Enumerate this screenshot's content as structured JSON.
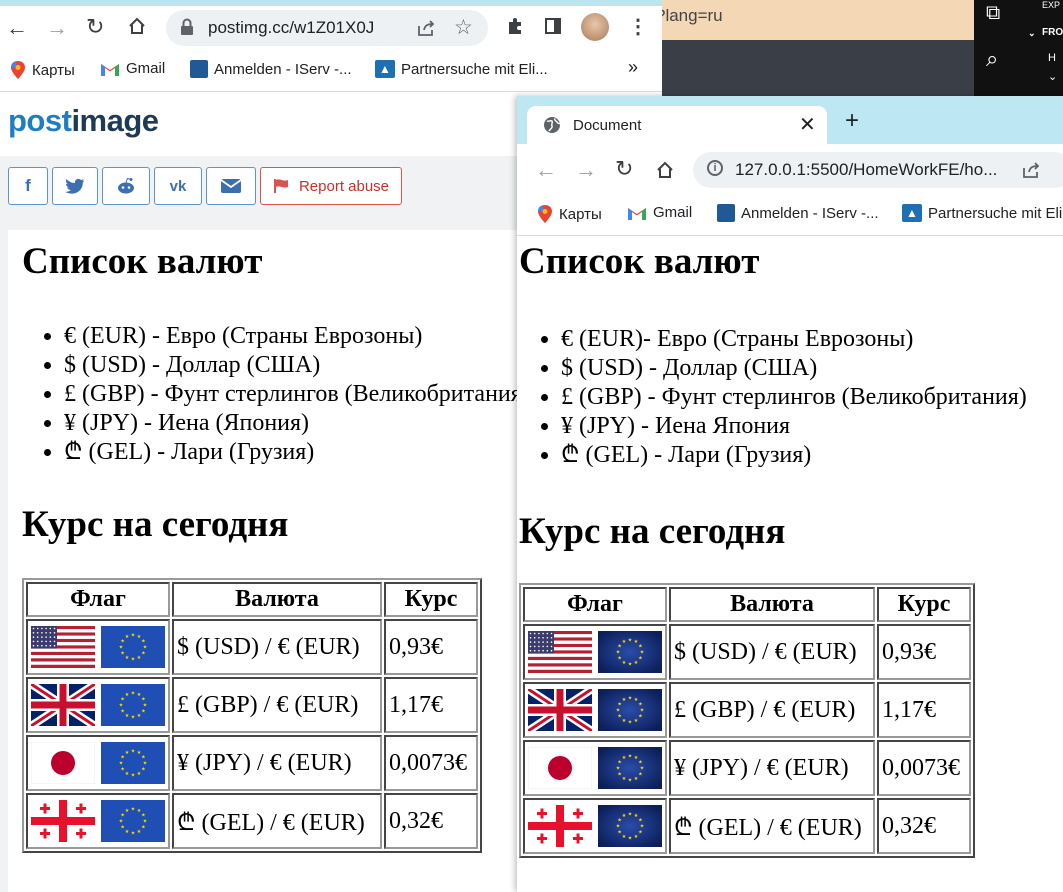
{
  "back_window": {
    "url": "postimg.cc/w1Z01X0J",
    "bookmarks": [
      "Карты",
      "Gmail",
      "Anmelden - IServ -...",
      "Partnersuche mit Eli..."
    ],
    "more_bookmarks": "»",
    "logo_part1": "post",
    "logo_part2": "image",
    "report_label": "Report abuse"
  },
  "background_window": {
    "url_fragment": "?lang=ru",
    "side_labels": [
      "EXP",
      "FRO",
      "H"
    ]
  },
  "front_window": {
    "tab_title": "Document",
    "url": "127.0.0.1:5500/HomeWorkFE/ho...",
    "bookmarks": [
      "Карты",
      "Gmail",
      "Anmelden - IServ -...",
      "Partnersuche mit Eli"
    ]
  },
  "doc_back": {
    "heading1": "Список валют",
    "currencies": [
      "€ (EUR) - Евро (Страны Еврозоны)",
      "$ (USD) - Доллар (США)",
      "£ (GBP) - Фунт стерлингов (Великобритания)",
      "¥ (JPY) - Иена (Япония)",
      "₾ (GEL) - Лари (Грузия)"
    ],
    "heading2": "Курс на сегодня",
    "table_headers": [
      "Флаг",
      "Валюта",
      "Курс"
    ],
    "rows": [
      {
        "pair": "$ (USD) / € (EUR)",
        "rate": "0,93€"
      },
      {
        "pair": "£ (GBP) / € (EUR)",
        "rate": "1,17€"
      },
      {
        "pair": "¥ (JPY) / € (EUR)",
        "rate": "0,0073€"
      },
      {
        "pair": "₾ (GEL) / € (EUR)",
        "rate": "0,32€"
      }
    ]
  },
  "doc_front": {
    "heading1": "Список валют",
    "currencies": [
      "€ (EUR)- Евро (Страны Еврозоны)",
      "$ (USD) - Доллар (США)",
      "£ (GBP) - Фунт стерлингов (Великобритания)",
      "¥ (JPY) - Иена Япония",
      "₾ (GEL) - Лари (Грузия)"
    ],
    "heading2": "Курс на сегодня",
    "table_headers": [
      "Флаг",
      "Валюта",
      "Курс"
    ],
    "rows": [
      {
        "pair": "$ (USD) / € (EUR)",
        "rate": "0,93€"
      },
      {
        "pair": "£ (GBP) / € (EUR)",
        "rate": "1,17€"
      },
      {
        "pair": "¥ (JPY) / € (EUR)",
        "rate": "0,0073€"
      },
      {
        "pair": "₾ (GEL) / € (EUR)",
        "rate": "0,32€"
      }
    ]
  },
  "colors": {
    "tabstrip": "#bde8f3",
    "postimage_blue": "#1f7ec2",
    "report_red": "#d9534f"
  }
}
